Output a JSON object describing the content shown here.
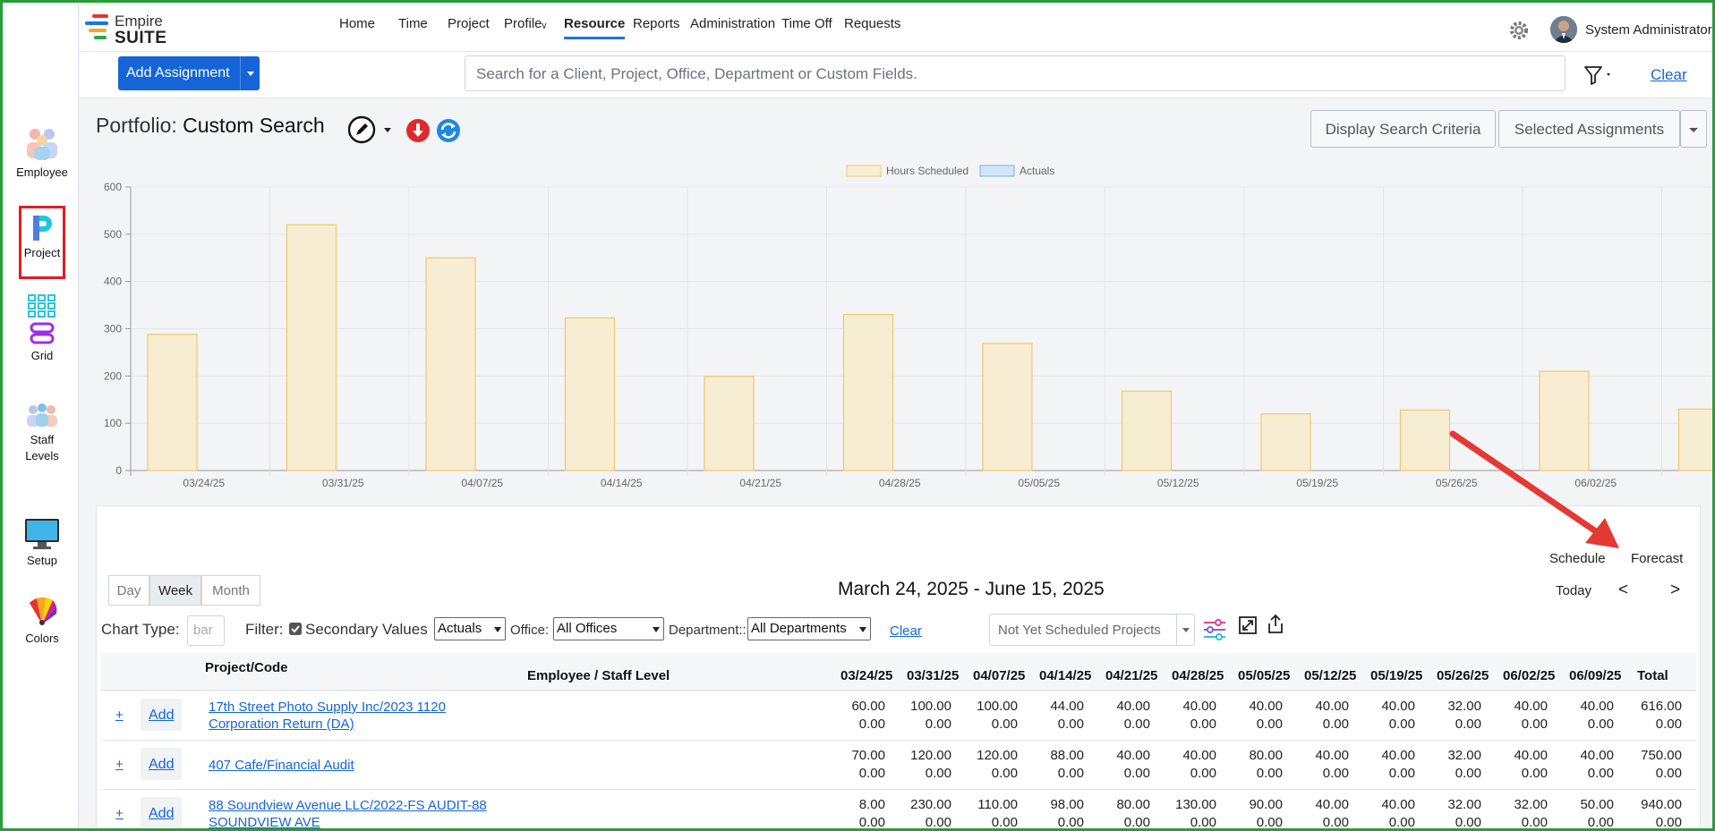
{
  "sidebar": {
    "items": [
      {
        "label": "Employee"
      },
      {
        "label": "Project"
      },
      {
        "label": "Grid"
      },
      {
        "label": "Staff Levels"
      },
      {
        "label": "Setup"
      },
      {
        "label": "Colors"
      }
    ]
  },
  "brand": {
    "line1": "Empire",
    "line2": "SUITE"
  },
  "nav": {
    "items": [
      "Home",
      "Time",
      "Project",
      "Profileᵥ",
      "Resource",
      "Reports",
      "Administration",
      "Time Off",
      "Requests"
    ],
    "active": "Resource"
  },
  "user": {
    "name": "System Administrator"
  },
  "toolbar": {
    "add_assignment": "Add Assignment",
    "search_placeholder": "Search for a Client, Project, Office, Department or Custom Fields.",
    "clear": "Clear"
  },
  "portfolio": {
    "label": "Portfolio:",
    "value": "Custom Search",
    "display_criteria": "Display Search Criteria",
    "selected_assignments": "Selected Assignments"
  },
  "chart_data": {
    "type": "bar",
    "categories": [
      "03/24/25",
      "03/31/25",
      "04/07/25",
      "04/14/25",
      "04/21/25",
      "04/28/25",
      "05/05/25",
      "05/12/25",
      "05/19/25",
      "05/26/25",
      "06/02/25",
      "06/09/25"
    ],
    "series": [
      {
        "name": "Hours Scheduled",
        "values": [
          288,
          520,
          450,
          323,
          199,
          330,
          269,
          168,
          120,
          128,
          210,
          130
        ]
      },
      {
        "name": "Actuals",
        "values": [
          0,
          0,
          0,
          0,
          0,
          0,
          0,
          0,
          0,
          0,
          0,
          0
        ]
      }
    ],
    "yticks": [
      0,
      100,
      200,
      300,
      400,
      500,
      600
    ],
    "ylim": [
      0,
      600
    ],
    "legend": "top",
    "grid": true,
    "colors": {
      "scheduled_fill": "#f7edd3",
      "scheduled_stroke": "#f2c86a",
      "actuals_fill": "#cfe6f7",
      "actuals_stroke": "#7ab5e0"
    }
  },
  "panel": {
    "schedule": "Schedule",
    "forecast": "Forecast",
    "views": [
      "Day",
      "Week",
      "Month"
    ],
    "selected_view": "Week",
    "date_range": "March 24, 2025 - June 15, 2025",
    "today": "Today",
    "prev": "<",
    "next": ">",
    "chart_type_label": "Chart Type:",
    "chart_type_placeholder": "bar",
    "filter_label": "Filter:",
    "secondary_values": "Secondary Values",
    "actuals_select": "Actuals",
    "office_label": "Office:",
    "office_select": "All Offices",
    "department_label": "Department::",
    "department_select": "All Departments",
    "clear": "Clear",
    "not_scheduled": "Not Yet Scheduled Projects"
  },
  "table": {
    "col_project": "Project/Code",
    "col_employee": "Employee / Staff Level",
    "weeks": [
      "03/24/25",
      "03/31/25",
      "04/07/25",
      "04/14/25",
      "04/21/25",
      "04/28/25",
      "05/05/25",
      "05/12/25",
      "05/19/25",
      "05/26/25",
      "06/02/25",
      "06/09/25"
    ],
    "col_total": "Total",
    "plus": "+",
    "add": "Add",
    "rows": [
      {
        "project": "17th Street Photo Supply Inc/2023 1120 Corporation Return (DA)",
        "top": [
          "60.00",
          "100.00",
          "100.00",
          "44.00",
          "40.00",
          "40.00",
          "40.00",
          "40.00",
          "40.00",
          "32.00",
          "40.00",
          "40.00",
          "616.00"
        ],
        "bottom": [
          "0.00",
          "0.00",
          "0.00",
          "0.00",
          "0.00",
          "0.00",
          "0.00",
          "0.00",
          "0.00",
          "0.00",
          "0.00",
          "0.00",
          "0.00"
        ]
      },
      {
        "project": "407 Cafe/Financial Audit",
        "top": [
          "70.00",
          "120.00",
          "120.00",
          "88.00",
          "40.00",
          "40.00",
          "80.00",
          "40.00",
          "40.00",
          "32.00",
          "40.00",
          "40.00",
          "750.00"
        ],
        "bottom": [
          "0.00",
          "0.00",
          "0.00",
          "0.00",
          "0.00",
          "0.00",
          "0.00",
          "0.00",
          "0.00",
          "0.00",
          "0.00",
          "0.00",
          "0.00"
        ]
      },
      {
        "project": "88 Soundview Avenue LLC/2022-FS AUDIT-88 SOUNDVIEW AVE",
        "top": [
          "8.00",
          "230.00",
          "110.00",
          "98.00",
          "80.00",
          "130.00",
          "90.00",
          "40.00",
          "40.00",
          "32.00",
          "32.00",
          "50.00",
          "940.00"
        ],
        "bottom": [
          "0.00",
          "0.00",
          "0.00",
          "0.00",
          "0.00",
          "0.00",
          "0.00",
          "0.00",
          "0.00",
          "0.00",
          "0.00",
          "0.00",
          "0.00"
        ]
      }
    ]
  }
}
